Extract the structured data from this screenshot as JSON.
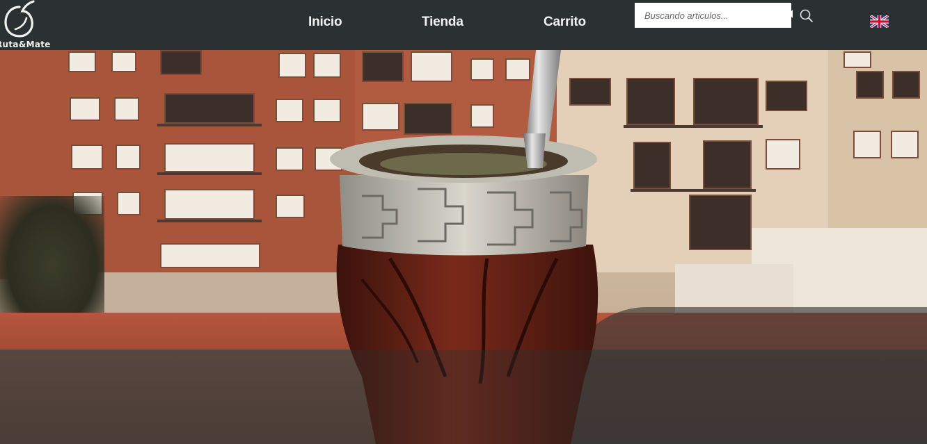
{
  "brand": {
    "name": "Ruta&Mate"
  },
  "nav": {
    "items": [
      {
        "label": "Inicio"
      },
      {
        "label": "Tienda"
      },
      {
        "label": "Carrito"
      }
    ]
  },
  "search": {
    "placeholder": "Buscando articulos..."
  },
  "icons": {
    "logo": "gourd-logo-icon",
    "search": "search-icon",
    "language": "uk-flag-icon"
  },
  "colors": {
    "header_bg": "#2b3133",
    "nav_text": "#f3f3f3"
  }
}
